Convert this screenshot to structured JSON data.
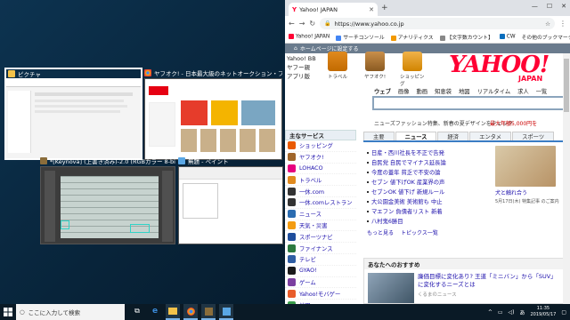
{
  "switcher": {
    "windows": [
      {
        "title": "ピクチャ"
      },
      {
        "title": "ヤフオク! - 日本最大級のネットオークション・フリマアプリ - Googl..."
      },
      {
        "title": "*[Keynova] (上書き済み)-2.0 (RGBカラー 8-bit gamma integ..."
      },
      {
        "title": "無題 - ペイント"
      }
    ]
  },
  "browser": {
    "tab_title": "Yahoo! JAPAN",
    "url": "https://www.yahoo.co.jp",
    "bookmarks": [
      "Yahoo! JAPAN",
      "サーチコンソール",
      "アナリティクス",
      "【文字数カウント】",
      "CW",
      "その他のブックマーク"
    ],
    "home_notice": "ホームページに設定する",
    "left_links": [
      "Yahoo! BB",
      "ヤフー親",
      "アプリ版"
    ],
    "services": [
      "トラベル",
      "ヤフオク!",
      "ショッピング"
    ],
    "logo": "YAHOO!",
    "logo_sub": "JAPAN",
    "search_tabs": [
      "ウェブ",
      "画像",
      "動画",
      "知恵袋",
      "地図",
      "リアルタイム",
      "求人",
      "一覧"
    ],
    "notice_left": "ニューズファッション特集、新春の夏デザインをチェック",
    "notice_right": "最大年額5,000円を",
    "sidebar_header": "主なサービス",
    "sidebar_items": [
      "ショッピング",
      "ヤフオク!",
      "LOHACO",
      "トラベル",
      "一休.com",
      "一休.comレストラン",
      "ニュース",
      "天気・災害",
      "スポーツナビ",
      "ファイナンス",
      "テレビ",
      "GYAO!",
      "ゲーム",
      "Yahoo!モバゲー",
      "地図"
    ],
    "news_tabs": [
      "主要",
      "ニュース",
      "経済",
      "エンタメ",
      "スポーツ"
    ],
    "news_items": [
      "日産・西川社長を不正で告発",
      "自民党 自民でマイナス延長論",
      "今度の蓋年 貧乏で不安の論",
      "セブン 値下げOK 産業界の声",
      "セブンOK 値下げ 新規ルール",
      "大公園金美術 美術館も 中止",
      "マエフン 負債者リスト 新着",
      "八村鬼6勝目"
    ],
    "news_more": [
      "もっと見る",
      "トピックス一覧"
    ],
    "photo_caption": "犬と触れ合う",
    "photo_sub": "5月17日(木) 特集記事 のご案内",
    "rec_header": "あなたへのおすすめ",
    "rec_title": "廉価目標に変化あり? 王道「ミニバン」から「SUV」に変化するニーズとは",
    "rec_source": "くるまのニュース"
  },
  "taskbar": {
    "search_placeholder": "ここに入力して検索",
    "time": "11:35",
    "date": "2019/05/17",
    "ime": "あ"
  },
  "colors": {
    "yahoo_red": "#ff0033",
    "link": "#1a0dab",
    "taskbar": "#0a1a26"
  }
}
